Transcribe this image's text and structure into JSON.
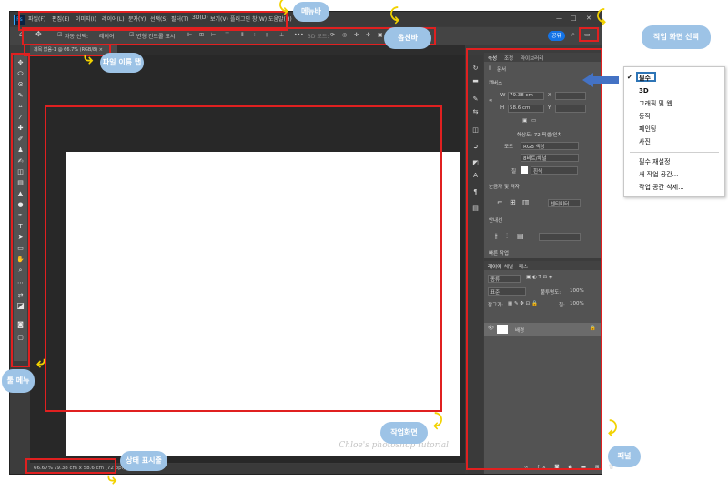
{
  "menubar": {
    "logo": "Ps",
    "items": [
      "파일(F)",
      "편집(E)",
      "이미지(I)",
      "레이어(L)",
      "문자(Y)",
      "선택(S)",
      "필터(T)",
      "3D(D)",
      "보기(V)",
      "플러그인",
      "창(W)",
      "도움말(H)"
    ],
    "window_buttons": [
      "—",
      "□",
      "✕"
    ]
  },
  "optionsbar": {
    "auto_select": "자동 선택:",
    "layer_select": "레이어",
    "transform_controls": "변형 컨트롤 표시",
    "mode_3d": "3D 모드:",
    "more": "•••",
    "share": "공유"
  },
  "document": {
    "tab_label": "제목 없음-1 @ 66.7% (RGB/8) ×",
    "watermark": "Chloe's photoshop tutorial"
  },
  "statusbar": {
    "zoom": "66.67%",
    "doc_size": "79.38 cm x 58.6 cm (72 ppi)"
  },
  "properties_panel": {
    "tabs": [
      "속성",
      "조정",
      "라이브러리"
    ],
    "doc_type": "문서",
    "section_canvas": "캔버스",
    "w_label": "W",
    "w_value": "79.38 cm",
    "x_label": "X",
    "h_label": "H",
    "h_value": "58.6 cm",
    "y_label": "Y",
    "resolution": "해상도: 72 픽셀/인치",
    "mode_label": "모드",
    "mode_value": "RGB 색상",
    "bits_value": "8비트/채널",
    "fill_label": "칠",
    "fill_value": "흰색",
    "section_rulers": "눈금자 및 격자",
    "ruler_unit": "센티미터",
    "section_guides": "안내선",
    "section_quick": "빠른 작업"
  },
  "layers_panel": {
    "tabs": [
      "레이어",
      "채널",
      "패스"
    ],
    "kind": "종류",
    "blend_mode": "표준",
    "opacity_label": "불투명도:",
    "opacity_value": "100%",
    "lock_label": "잠그기:",
    "fill_label": "칠:",
    "fill_value": "100%",
    "layer_name": "배경"
  },
  "workspace_menu": {
    "selected": "필수",
    "items": [
      "필수",
      "3D",
      "그래픽 및 웹",
      "동작",
      "페인팅",
      "사진"
    ],
    "actions": [
      "필수 재설정",
      "새 작업 공간...",
      "작업 공간 삭제..."
    ]
  },
  "annotations": {
    "menubar": "메뉴바",
    "optionbar": "옵션바",
    "workspace_select": "작업 화면 선택",
    "file_tab": "파일 이름 탭",
    "tools_menu": "툴 메뉴",
    "workarea": "작업화면",
    "statusbar": "상태 표시줄",
    "panel": "패널"
  },
  "colors": {
    "highlight": "#e02020",
    "callout": "#9dc3e6",
    "arrow": "#f2d200",
    "selection_box": "#2e75b6",
    "share_button": "#1473e6"
  }
}
